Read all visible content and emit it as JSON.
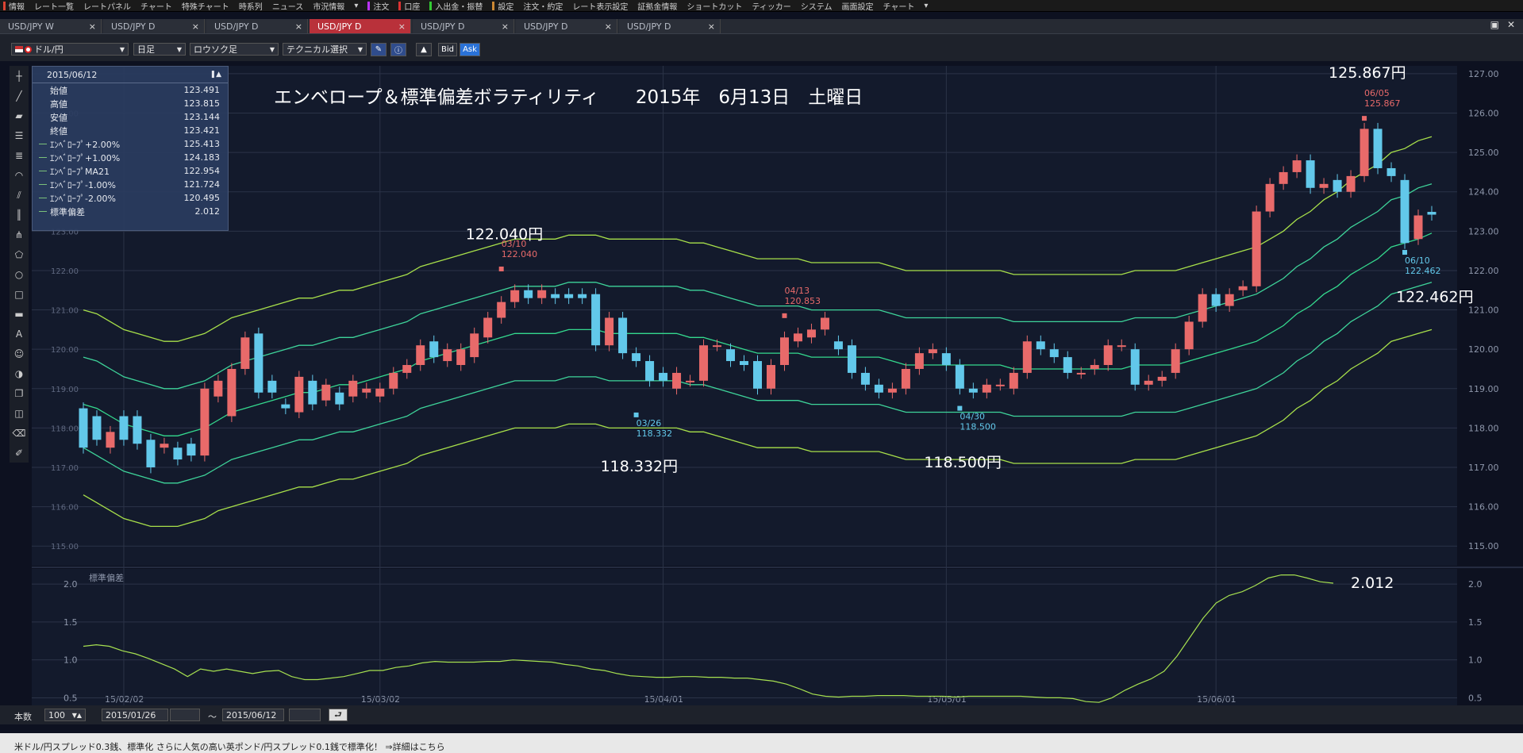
{
  "menu": [
    "情報",
    "レート一覧",
    "レートパネル",
    "チャート",
    "特殊チャート",
    "時系列",
    "ニュース",
    "市況情報",
    "▾",
    "注文",
    "口座",
    "入出金・振替",
    "設定",
    "注文・約定",
    "レート表示設定",
    "証拠金情報",
    "ショートカット",
    "ティッカー",
    "システム",
    "画面設定",
    "チャート",
    "▾"
  ],
  "menu_markers": [
    "#d43",
    "",
    "",
    "",
    "",
    "",
    "",
    "",
    "",
    "#b3f",
    "#d33",
    "#3c3",
    "#c83",
    "",
    "",
    "",
    "",
    "",
    "",
    "",
    "",
    ""
  ],
  "tabs": [
    {
      "label": "USD/JPY W",
      "active": false
    },
    {
      "label": "USD/JPY D",
      "active": false
    },
    {
      "label": "USD/JPY D",
      "active": false
    },
    {
      "label": "USD/JPY D",
      "active": true
    },
    {
      "label": "USD/JPY D",
      "active": false
    },
    {
      "label": "USD/JPY D",
      "active": false
    },
    {
      "label": "USD/JPY D",
      "active": false
    }
  ],
  "close_glyph": "×",
  "window_controls": [
    "▣",
    "✕"
  ],
  "toolbar": {
    "pair": "ドル/円",
    "period": "日足",
    "chart_type": "ロウソク足",
    "technical": "テクニカル選択",
    "bid": "Bid",
    "ask": "Ask"
  },
  "info_panel": {
    "date": "2015/06/12",
    "rows": [
      {
        "label": "始値",
        "value": "123.491",
        "line": false
      },
      {
        "label": "高値",
        "value": "123.815",
        "line": false
      },
      {
        "label": "安値",
        "value": "123.144",
        "line": false
      },
      {
        "label": "終値",
        "value": "123.421",
        "line": false
      },
      {
        "label": "ｴﾝﾍﾞﾛｰﾌﾟ+2.00%",
        "value": "125.413",
        "line": true
      },
      {
        "label": "ｴﾝﾍﾞﾛｰﾌﾟ+1.00%",
        "value": "124.183",
        "line": true
      },
      {
        "label": "ｴﾝﾍﾞﾛｰﾌﾟMA21",
        "value": "122.954",
        "line": true
      },
      {
        "label": "ｴﾝﾍﾞﾛｰﾌﾟ-1.00%",
        "value": "121.724",
        "line": true
      },
      {
        "label": "ｴﾝﾍﾞﾛｰﾌﾟ-2.00%",
        "value": "120.495",
        "line": true
      },
      {
        "label": "標準偏差",
        "value": "2.012",
        "line": true
      }
    ]
  },
  "chart_title": "エンベロープ＆標準偏差ボラティリティ　　2015年　6月13日　土曜日",
  "chart_data": {
    "type": "candlestick",
    "y_axis_ticks": [
      "127.00",
      "126.00",
      "125.00",
      "124.00",
      "123.00",
      "122.00",
      "121.00",
      "120.00",
      "119.00",
      "118.00",
      "117.00",
      "116.00",
      "115.00"
    ],
    "ylim": [
      114.5,
      127.2
    ],
    "x_axis_ticks": [
      "15/02/02",
      "15/03/02",
      "15/04/01",
      "15/05/01",
      "15/06/01"
    ],
    "x_tick_index": [
      3,
      22,
      43,
      64,
      84
    ],
    "candles": [
      [
        118.5,
        117.5
      ],
      [
        118.3,
        117.7
      ],
      [
        117.5,
        117.9
      ],
      [
        118.3,
        117.7
      ],
      [
        118.3,
        117.6
      ],
      [
        117.7,
        117.0
      ],
      [
        117.5,
        117.6
      ],
      [
        117.5,
        117.2
      ],
      [
        117.6,
        117.3
      ],
      [
        117.3,
        119.0
      ],
      [
        118.8,
        119.2
      ],
      [
        118.3,
        119.5
      ],
      [
        119.5,
        120.3
      ],
      [
        120.4,
        118.9
      ],
      [
        119.2,
        118.9
      ],
      [
        118.6,
        118.5
      ],
      [
        118.4,
        119.3
      ],
      [
        119.2,
        118.6
      ],
      [
        118.7,
        119.1
      ],
      [
        118.9,
        118.6
      ],
      [
        118.8,
        119.2
      ],
      [
        118.9,
        119.0
      ],
      [
        118.8,
        119.0
      ],
      [
        119.0,
        119.4
      ],
      [
        119.4,
        119.6
      ],
      [
        119.6,
        120.1
      ],
      [
        120.2,
        119.8
      ],
      [
        119.7,
        120.0
      ],
      [
        119.6,
        120.0
      ],
      [
        119.8,
        120.4
      ],
      [
        120.3,
        120.8
      ],
      [
        120.8,
        121.2
      ],
      [
        121.2,
        121.5
      ],
      [
        121.5,
        121.3
      ],
      [
        121.3,
        121.5
      ],
      [
        121.4,
        121.3
      ],
      [
        121.4,
        121.3
      ],
      [
        121.4,
        121.3
      ],
      [
        121.4,
        120.1
      ],
      [
        120.1,
        120.8
      ],
      [
        120.8,
        119.9
      ],
      [
        119.9,
        119.7
      ],
      [
        119.7,
        119.2
      ],
      [
        119.4,
        119.2
      ],
      [
        119.0,
        119.4
      ],
      [
        119.2,
        119.2
      ],
      [
        119.2,
        120.1
      ],
      [
        120.1,
        120.1
      ],
      [
        120.0,
        119.7
      ],
      [
        119.7,
        119.6
      ],
      [
        119.7,
        119.0
      ],
      [
        119.0,
        119.6
      ],
      [
        119.6,
        120.3
      ],
      [
        120.2,
        120.4
      ],
      [
        120.3,
        120.5
      ],
      [
        120.5,
        120.8
      ],
      [
        120.2,
        120.0
      ],
      [
        120.1,
        119.4
      ],
      [
        119.4,
        119.1
      ],
      [
        119.1,
        118.9
      ],
      [
        118.9,
        119.0
      ],
      [
        119.0,
        119.5
      ],
      [
        119.5,
        119.9
      ],
      [
        119.9,
        120.0
      ],
      [
        119.9,
        119.6
      ],
      [
        119.6,
        119.0
      ],
      [
        119.0,
        118.9
      ],
      [
        118.9,
        119.1
      ],
      [
        119.1,
        119.1
      ],
      [
        119.0,
        119.4
      ],
      [
        119.4,
        120.2
      ],
      [
        120.2,
        120.0
      ],
      [
        120.0,
        119.8
      ],
      [
        119.8,
        119.4
      ],
      [
        119.4,
        119.4
      ],
      [
        119.5,
        119.6
      ],
      [
        119.6,
        120.1
      ],
      [
        120.1,
        120.1
      ],
      [
        120.0,
        119.1
      ],
      [
        119.1,
        119.2
      ],
      [
        119.2,
        119.3
      ],
      [
        119.4,
        120.0
      ],
      [
        120.0,
        120.7
      ],
      [
        120.7,
        121.4
      ],
      [
        121.4,
        121.1
      ],
      [
        121.1,
        121.4
      ],
      [
        121.5,
        121.6
      ],
      [
        121.6,
        123.5
      ],
      [
        123.5,
        124.2
      ],
      [
        124.2,
        124.5
      ],
      [
        124.5,
        124.8
      ],
      [
        124.8,
        124.1
      ],
      [
        124.1,
        124.2
      ],
      [
        124.3,
        124.0
      ],
      [
        124.0,
        124.4
      ],
      [
        124.4,
        125.6
      ],
      [
        125.6,
        124.6
      ],
      [
        124.6,
        124.4
      ],
      [
        124.3,
        122.7
      ],
      [
        122.8,
        123.4
      ],
      [
        123.49,
        123.42
      ]
    ],
    "envelope_series": [
      {
        "name": "ｴﾝﾍﾞﾛｰﾌﾟ+2.00%",
        "values": [
          121.0,
          120.9,
          120.7,
          120.5,
          120.4,
          120.3,
          120.2,
          120.2,
          120.3,
          120.4,
          120.6,
          120.8,
          120.9,
          121.0,
          121.1,
          121.2,
          121.3,
          121.3,
          121.4,
          121.5,
          121.5,
          121.6,
          121.7,
          121.8,
          121.9,
          122.1,
          122.2,
          122.3,
          122.4,
          122.5,
          122.6,
          122.7,
          122.8,
          122.8,
          122.8,
          122.8,
          122.9,
          122.9,
          122.9,
          122.8,
          122.8,
          122.8,
          122.8,
          122.8,
          122.8,
          122.7,
          122.7,
          122.6,
          122.5,
          122.4,
          122.3,
          122.3,
          122.3,
          122.3,
          122.2,
          122.2,
          122.2,
          122.2,
          122.2,
          122.2,
          122.1,
          122.0,
          122.0,
          122.0,
          122.0,
          122.0,
          122.0,
          122.0,
          122.0,
          121.9,
          121.9,
          121.9,
          121.9,
          121.9,
          121.9,
          121.9,
          121.9,
          121.9,
          122.0,
          122.0,
          122.0,
          122.0,
          122.1,
          122.2,
          122.3,
          122.4,
          122.5,
          122.6,
          122.8,
          123.0,
          123.3,
          123.5,
          123.8,
          124.0,
          124.3,
          124.5,
          124.7,
          125.0,
          125.1,
          125.3,
          125.4
        ]
      },
      {
        "name": "ｴﾝﾍﾞﾛｰﾌﾟ+1.00%",
        "values": [
          119.8,
          119.7,
          119.5,
          119.3,
          119.2,
          119.1,
          119.0,
          119.0,
          119.1,
          119.2,
          119.4,
          119.6,
          119.7,
          119.8,
          119.9,
          120.0,
          120.1,
          120.1,
          120.2,
          120.3,
          120.3,
          120.4,
          120.5,
          120.6,
          120.7,
          120.9,
          121.0,
          121.1,
          121.2,
          121.3,
          121.4,
          121.5,
          121.6,
          121.6,
          121.6,
          121.6,
          121.7,
          121.7,
          121.7,
          121.6,
          121.6,
          121.6,
          121.6,
          121.6,
          121.6,
          121.5,
          121.5,
          121.4,
          121.3,
          121.2,
          121.1,
          121.1,
          121.1,
          121.1,
          121.0,
          121.0,
          121.0,
          121.0,
          121.0,
          121.0,
          120.9,
          120.8,
          120.8,
          120.8,
          120.8,
          120.8,
          120.8,
          120.8,
          120.8,
          120.7,
          120.7,
          120.7,
          120.7,
          120.7,
          120.7,
          120.7,
          120.7,
          120.7,
          120.8,
          120.8,
          120.8,
          120.8,
          120.9,
          121.0,
          121.1,
          121.2,
          121.3,
          121.4,
          121.6,
          121.8,
          122.1,
          122.3,
          122.6,
          122.8,
          123.1,
          123.3,
          123.5,
          123.8,
          123.9,
          124.1,
          124.2
        ]
      },
      {
        "name": "ｴﾝﾍﾞﾛｰﾌﾟMA21",
        "values": [
          118.6,
          118.5,
          118.3,
          118.1,
          118.0,
          117.9,
          117.8,
          117.8,
          117.9,
          118.0,
          118.2,
          118.4,
          118.5,
          118.6,
          118.7,
          118.8,
          118.9,
          118.9,
          119.0,
          119.1,
          119.1,
          119.2,
          119.3,
          119.4,
          119.5,
          119.7,
          119.8,
          119.9,
          120.0,
          120.1,
          120.2,
          120.3,
          120.4,
          120.4,
          120.4,
          120.4,
          120.5,
          120.5,
          120.5,
          120.4,
          120.4,
          120.4,
          120.4,
          120.4,
          120.4,
          120.3,
          120.3,
          120.2,
          120.1,
          120.0,
          119.9,
          119.9,
          119.9,
          119.9,
          119.8,
          119.8,
          119.8,
          119.8,
          119.8,
          119.8,
          119.7,
          119.6,
          119.6,
          119.6,
          119.6,
          119.6,
          119.6,
          119.6,
          119.6,
          119.5,
          119.5,
          119.5,
          119.5,
          119.5,
          119.5,
          119.5,
          119.5,
          119.5,
          119.6,
          119.6,
          119.6,
          119.6,
          119.7,
          119.8,
          119.9,
          120.0,
          120.1,
          120.2,
          120.4,
          120.6,
          120.9,
          121.1,
          121.4,
          121.6,
          121.9,
          122.1,
          122.3,
          122.6,
          122.7,
          122.8,
          122.95
        ]
      },
      {
        "name": "ｴﾝﾍﾞﾛｰﾌﾟ-1.00%",
        "values": [
          117.5,
          117.3,
          117.1,
          116.9,
          116.8,
          116.7,
          116.6,
          116.6,
          116.7,
          116.8,
          117.0,
          117.2,
          117.3,
          117.4,
          117.5,
          117.6,
          117.7,
          117.7,
          117.8,
          117.9,
          117.9,
          118.0,
          118.1,
          118.2,
          118.3,
          118.5,
          118.6,
          118.7,
          118.8,
          118.9,
          119.0,
          119.1,
          119.2,
          119.2,
          119.2,
          119.2,
          119.3,
          119.3,
          119.3,
          119.2,
          119.2,
          119.2,
          119.2,
          119.2,
          119.2,
          119.1,
          119.1,
          119.0,
          118.9,
          118.8,
          118.7,
          118.7,
          118.7,
          118.7,
          118.6,
          118.6,
          118.6,
          118.6,
          118.6,
          118.6,
          118.5,
          118.4,
          118.4,
          118.4,
          118.4,
          118.4,
          118.4,
          118.4,
          118.4,
          118.3,
          118.3,
          118.3,
          118.3,
          118.3,
          118.3,
          118.3,
          118.3,
          118.3,
          118.4,
          118.4,
          118.4,
          118.4,
          118.5,
          118.6,
          118.7,
          118.8,
          118.9,
          119.0,
          119.2,
          119.4,
          119.7,
          119.9,
          120.2,
          120.4,
          120.7,
          120.9,
          121.1,
          121.4,
          121.5,
          121.6,
          121.7
        ]
      },
      {
        "name": "ｴﾝﾍﾞﾛｰﾌﾟ-2.00%",
        "values": [
          116.3,
          116.1,
          115.9,
          115.7,
          115.6,
          115.5,
          115.5,
          115.5,
          115.6,
          115.7,
          115.9,
          116.0,
          116.1,
          116.2,
          116.3,
          116.4,
          116.5,
          116.5,
          116.6,
          116.7,
          116.7,
          116.8,
          116.9,
          117.0,
          117.1,
          117.3,
          117.4,
          117.5,
          117.6,
          117.7,
          117.8,
          117.9,
          118.0,
          118.0,
          118.0,
          118.0,
          118.1,
          118.1,
          118.1,
          118.0,
          118.0,
          118.0,
          118.0,
          118.0,
          118.0,
          117.9,
          117.9,
          117.8,
          117.7,
          117.6,
          117.5,
          117.5,
          117.5,
          117.5,
          117.4,
          117.4,
          117.4,
          117.4,
          117.4,
          117.4,
          117.3,
          117.2,
          117.2,
          117.2,
          117.2,
          117.2,
          117.2,
          117.2,
          117.2,
          117.1,
          117.1,
          117.1,
          117.1,
          117.1,
          117.1,
          117.1,
          117.1,
          117.1,
          117.2,
          117.2,
          117.2,
          117.2,
          117.3,
          117.4,
          117.5,
          117.6,
          117.7,
          117.8,
          118.0,
          118.2,
          118.5,
          118.7,
          119.0,
          119.2,
          119.5,
          119.7,
          119.9,
          120.2,
          120.3,
          120.4,
          120.5
        ]
      }
    ],
    "markers": [
      {
        "index": 31,
        "date": "03/10",
        "value": "122.040",
        "price": 122.04,
        "pos": "high"
      },
      {
        "index": 41,
        "date": "03/26",
        "value": "118.332",
        "price": 118.332,
        "pos": "low"
      },
      {
        "index": 52,
        "date": "04/13",
        "value": "120.853",
        "price": 120.853,
        "pos": "high"
      },
      {
        "index": 65,
        "date": "04/30",
        "value": "118.500",
        "price": 118.5,
        "pos": "low"
      },
      {
        "index": 95,
        "date": "06/05",
        "value": "125.867",
        "price": 125.867,
        "pos": "high"
      },
      {
        "index": 98,
        "date": "06/10",
        "value": "122.462",
        "price": 122.462,
        "pos": "low"
      }
    ],
    "big_labels": [
      {
        "text": "122.040円",
        "index": 31,
        "price": 122.8
      },
      {
        "text": "118.332円",
        "index": 41,
        "price": 116.9
      },
      {
        "text": "118.500円",
        "index": 65,
        "price": 117.0
      },
      {
        "text": "125.867円",
        "index": 95,
        "price": 126.9
      },
      {
        "text": "122.462円",
        "index": 100,
        "price": 121.2
      }
    ],
    "sd_panel": {
      "title": "標準偏差",
      "y_ticks": [
        "2.0",
        "1.5",
        "1.0",
        "0.5"
      ],
      "ylim": [
        0.4,
        2.2
      ],
      "values": [
        1.18,
        1.2,
        1.18,
        1.12,
        1.08,
        1.02,
        0.95,
        0.88,
        0.78,
        0.88,
        0.85,
        0.88,
        0.85,
        0.82,
        0.85,
        0.86,
        0.78,
        0.74,
        0.74,
        0.76,
        0.78,
        0.82,
        0.86,
        0.86,
        0.9,
        0.92,
        0.96,
        0.98,
        0.97,
        0.97,
        0.97,
        0.98,
        0.98,
        1.0,
        0.99,
        0.98,
        0.97,
        0.94,
        0.92,
        0.88,
        0.86,
        0.82,
        0.79,
        0.78,
        0.77,
        0.77,
        0.78,
        0.78,
        0.77,
        0.77,
        0.76,
        0.76,
        0.74,
        0.72,
        0.68,
        0.62,
        0.55,
        0.52,
        0.51,
        0.52,
        0.52,
        0.53,
        0.53,
        0.53,
        0.52,
        0.52,
        0.52,
        0.51,
        0.52,
        0.52,
        0.52,
        0.52,
        0.52,
        0.51,
        0.5,
        0.5,
        0.49,
        0.45,
        0.44,
        0.5,
        0.6,
        0.68,
        0.75,
        0.85,
        1.05,
        1.3,
        1.55,
        1.75,
        1.85,
        1.9,
        1.98,
        2.08,
        2.12,
        2.12,
        2.08,
        2.03,
        2.012
      ],
      "label": "2.012"
    }
  },
  "bottom": {
    "count_label": "本数",
    "count": "100",
    "from": "2015/01/26",
    "tilde": "～",
    "to": "2015/06/12",
    "return": "⮐"
  },
  "status_text": "米ドル/円スプレッド0.3銭、標準化 さらに人気の高い英ポンド/円スプレッド0.1銭で標準化！ ⇒詳細はこちら",
  "colors": {
    "bull": "#e86a6a",
    "bear": "#62c8ea",
    "env_outer": "#a8e04a",
    "env_inner": "#3ed49a",
    "ma": "#34d98e",
    "grid": "#2b3347",
    "bg": "#131a2c",
    "accent": "#b9313a"
  }
}
